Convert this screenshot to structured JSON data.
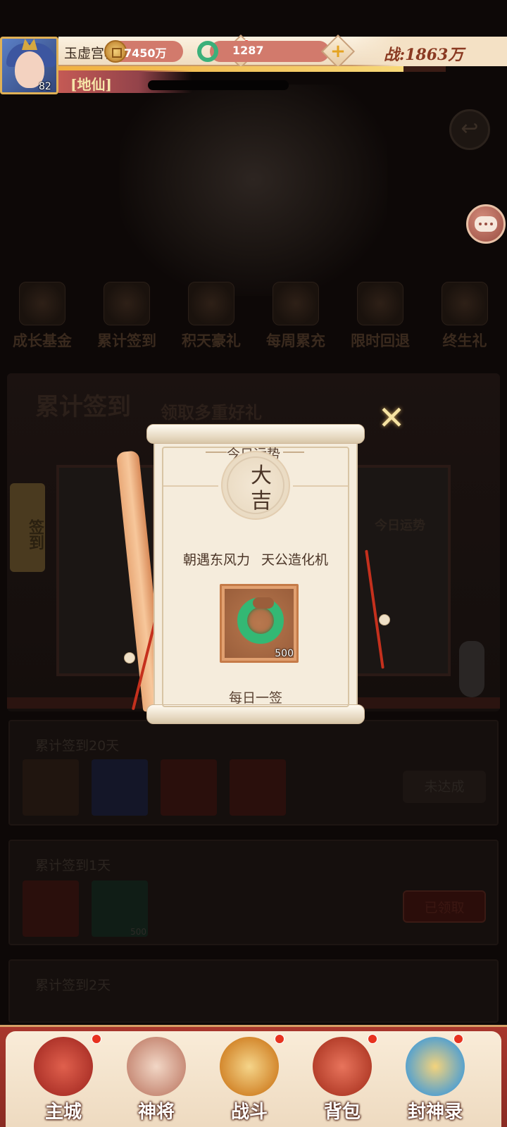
{
  "hud": {
    "player_name": "玉虚宫柳弘漫",
    "level": "82",
    "gold": "7450万",
    "jade": "1287",
    "power": "战:1863万",
    "rank": "[地仙]",
    "exp_progress": 0.89
  },
  "background": {
    "activity_tabs": [
      "成长基金",
      "累计签到",
      "积天豪礼",
      "每周累充",
      "限时回退",
      "终生礼"
    ],
    "event_title": "累计签到",
    "event_subtitle": "领取多重好礼",
    "sign_tag": "签到",
    "today_fortune_label": "今日运势",
    "rows": [
      {
        "label": "累计签到20天",
        "status": "未达成"
      },
      {
        "label": "累计签到1天",
        "status": "已领取",
        "slot_count": "500"
      },
      {
        "label": "累计签到2天"
      }
    ]
  },
  "dialog": {
    "title": "今日运势",
    "lot": "大吉",
    "poem": "朝遇东风力 天公造化机",
    "reward_count": "500",
    "footer": "每日一签",
    "close_icon": "✕"
  },
  "bottom_nav": {
    "items": [
      {
        "label": "主城",
        "dot": true
      },
      {
        "label": "神将",
        "dot": false
      },
      {
        "label": "战斗",
        "dot": true
      },
      {
        "label": "背包",
        "dot": true
      },
      {
        "label": "封神录",
        "dot": true
      }
    ]
  },
  "colors": {
    "accent_red": "#a8372c",
    "jade_green": "#33b874",
    "parchment": "#f5ecdc",
    "gold": "#e4a321"
  }
}
